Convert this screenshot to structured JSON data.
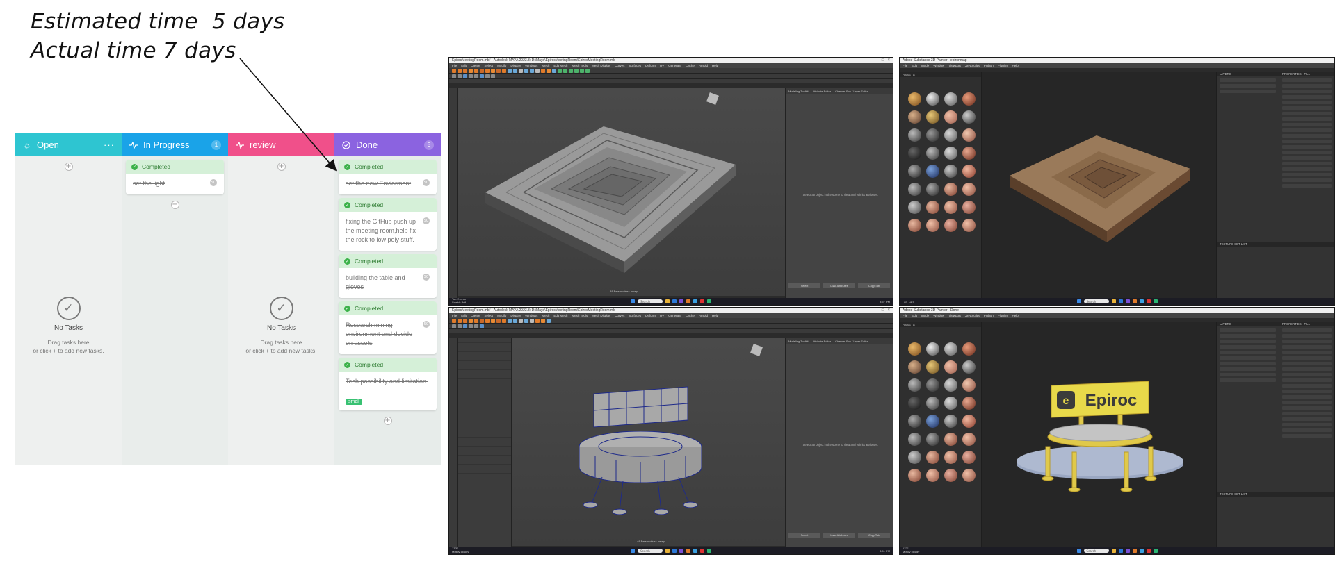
{
  "note": {
    "estimated": "Estimated time  5 days",
    "actual": "Actual time 7 days"
  },
  "board": {
    "columns": [
      {
        "title": "Open",
        "color": "#2ec5d1",
        "icon": "lightbulb-icon",
        "menu": "···",
        "empty_title": "No Tasks",
        "empty_sub": "Drag tasks here\nor click + to add new tasks."
      },
      {
        "title": "In Progress",
        "color": "#1aa3e8",
        "icon": "activity-icon",
        "count": "1"
      },
      {
        "title": "review",
        "color": "#f0508a",
        "icon": "activity-icon",
        "empty_title": "No Tasks",
        "empty_sub": "Drag tasks here\nor click + to add new tasks."
      },
      {
        "title": "Done",
        "color": "#8b63e0",
        "icon": "check-circle-icon",
        "count": "5"
      }
    ],
    "in_progress_cards": [
      {
        "status": "Completed",
        "text": "set the light",
        "avatar": "SC"
      }
    ],
    "done_cards": [
      {
        "status": "Completed",
        "text": "set the new Enviorment",
        "avatar": "SC"
      },
      {
        "status": "Completed",
        "text": "fixing the GitHub push up the meeting room,help fix the rock to low poly stuff.",
        "avatar": "SC"
      },
      {
        "status": "Completed",
        "text": "buliding the table and gloves",
        "avatar": "SC"
      },
      {
        "status": "Completed",
        "text": "Research mining environment and decide on assets",
        "avatar": "SC"
      },
      {
        "status": "Completed",
        "text": "Tech possibility and limitation.",
        "tag": "small"
      }
    ],
    "add_symbol": "+",
    "check_symbol": "✓"
  },
  "screens": {
    "maya_top": {
      "title": "EpirocMeetingRoom.mb* - Autodesk MAYA 2023.3: D:\\Maya\\EpirocMeetingRoom\\EpirocMeetingRoom.mb",
      "menus": [
        "File",
        "Edit",
        "Create",
        "Select",
        "Modify",
        "Display",
        "Windows",
        "Mesh",
        "Edit Mesh",
        "Mesh Tools",
        "Mesh Display",
        "Curves",
        "Surfaces",
        "Deform",
        "UV",
        "Generate",
        "Cache",
        "Arnold",
        "Help"
      ],
      "attr_tabs": [
        "Modeling Toolkit",
        "Attribute Editor",
        "Channel Box / Layer Editor"
      ],
      "attr_msg": "Select an object in the scene to view and edit its attributes.",
      "attr_buttons": [
        "Select",
        "Load Attributes",
        "Copy Tab"
      ],
      "vp_label": "48 Perspective : persp",
      "search": "Search",
      "time": "8:57 PM",
      "weather": "Top Events\nSnatch Bull"
    },
    "maya_bottom": {
      "title": "EpirocMeetingRoom.mb* - Autodesk MAYA 2023.3: D:\\Maya\\EpirocMeetingRoom\\EpirocMeetingRoom.mb",
      "menus": [
        "File",
        "Edit",
        "Create",
        "Select",
        "Modify",
        "Display",
        "Windows",
        "Mesh",
        "Edit Mesh",
        "Mesh Tools",
        "Mesh Display",
        "Curves",
        "Surfaces",
        "Deform",
        "UV",
        "Generate",
        "Cache",
        "Arnold",
        "Help"
      ],
      "attr_tabs": [
        "Modeling Toolkit",
        "Attribute Editor",
        "Channel Box / Layer Editor"
      ],
      "attr_msg": "Select an object in the scene to view and edit its attributes.",
      "attr_buttons": [
        "Select",
        "Load Attributes",
        "Copy Tab"
      ],
      "vp_label": "48 Perspective : persp",
      "search": "Search",
      "time": "8:51 PM",
      "weather": "13°F\nMostly cloudy"
    },
    "painter_top": {
      "title": "Adobe Substance 3D Painter - epironmap",
      "menus": [
        "File",
        "Edit",
        "Mode",
        "Window",
        "Viewport",
        "JavaScript",
        "Python",
        "Plugins",
        "Help"
      ],
      "assets_title": "ASSETS",
      "layers_title": "LAYERS",
      "props_title": "PROPERTIES - FILL",
      "texset_title": "TEXTURE SET LIST",
      "search": "Search",
      "weather": "U.S. HPT"
    },
    "painter_bottom": {
      "title": "Adobe Substance 3D Painter - Done",
      "menus": [
        "File",
        "Edit",
        "Mode",
        "Window",
        "Viewport",
        "JavaScript",
        "Python",
        "Plugins",
        "Help"
      ],
      "assets_title": "ASSETS",
      "layers_title": "LAYERS",
      "props_title": "PROPERTIES - FILL",
      "texset_title": "TEXTURE SET LIST",
      "search": "Search",
      "weather": "13°F\nMostly cloudy",
      "sign_text": "Epiroc",
      "sign_colors": {
        "sign": "#e8d94a",
        "text": "#3b3b3b",
        "table_top": "#b8b8b8",
        "legs": "#e0c94a",
        "base": "#9aa7c2"
      }
    }
  }
}
